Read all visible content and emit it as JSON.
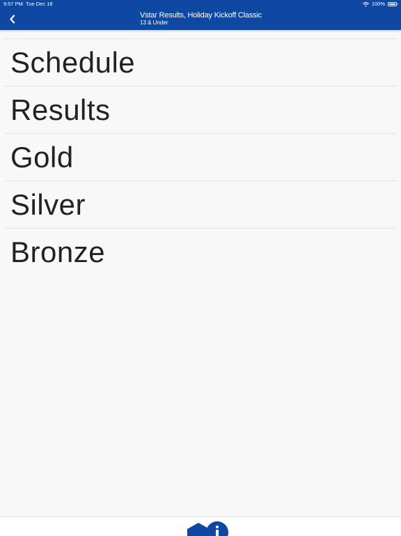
{
  "status_bar": {
    "time": "9:57 PM",
    "date": "Tue Dec 18",
    "battery": "100%",
    "wifi_icon": "wifi-icon",
    "battery_icon": "battery-icon"
  },
  "header": {
    "title": "Vstar Results, Holiday Kickoff Classic",
    "subtitle": "13 & Under",
    "back_icon": "chevron-left-icon",
    "background_color": "#0f48a3"
  },
  "menu": {
    "items": [
      {
        "label": "Schedule"
      },
      {
        "label": "Results"
      },
      {
        "label": "Gold"
      },
      {
        "label": "Silver"
      },
      {
        "label": "Bronze"
      }
    ]
  },
  "bottom_bar": {
    "home_icon": "home-icon",
    "info_icon": "info-icon"
  }
}
